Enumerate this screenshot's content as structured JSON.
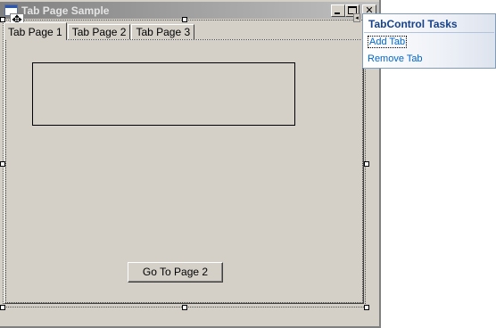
{
  "window": {
    "title": "Tab Page Sample",
    "close_glyph": "✕"
  },
  "tabs": [
    {
      "label": "Tab Page 1",
      "active": true
    },
    {
      "label": "Tab Page 2",
      "active": false
    },
    {
      "label": "Tab Page 3",
      "active": false
    }
  ],
  "content": {
    "go_button_label": "Go To Page 2"
  },
  "designer": {
    "move_glyph": "✥",
    "smart_tag_glyph": "◂"
  },
  "tasks_panel": {
    "title": "TabControl Tasks",
    "items": [
      {
        "label": "Add Tab"
      },
      {
        "label": "Remove Tab"
      }
    ]
  }
}
